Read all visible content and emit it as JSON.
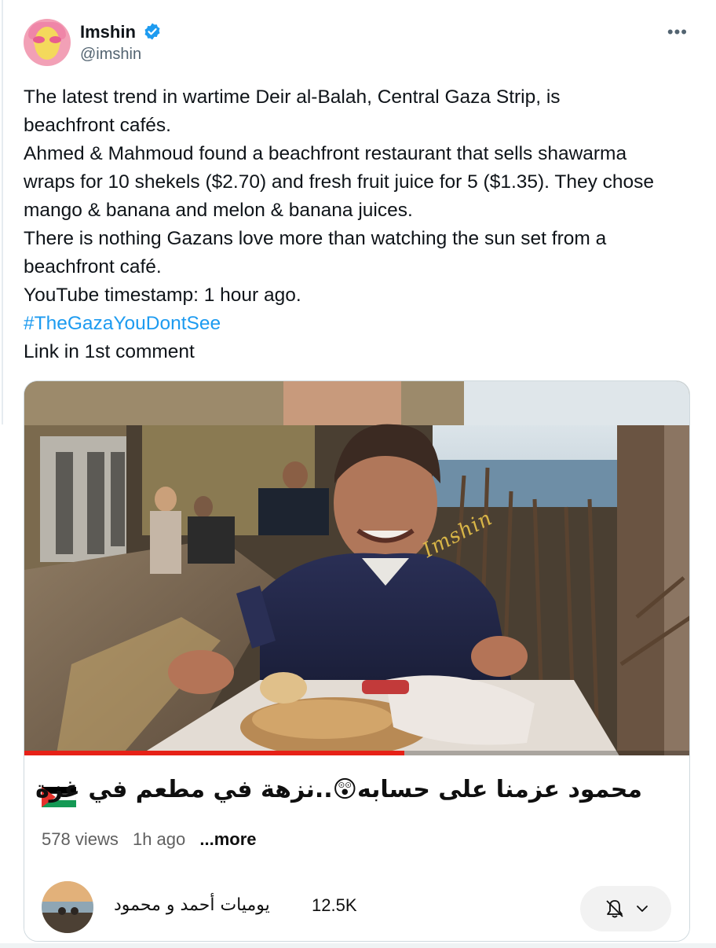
{
  "author": {
    "display_name": "Imshin",
    "handle": "@imshin",
    "verified": true,
    "verified_color": "#1d9bf0",
    "avatar_icon": "avatar-illustration"
  },
  "menu_icon": "more-horizontal-icon",
  "tweet": {
    "lines": [
      "The latest trend in wartime Deir al-Balah, Central Gaza Strip, is",
      "beachfront cafés.",
      "Ahmed & Mahmoud found a beachfront restaurant that sells shawarma",
      "wraps for 10 shekels ($2.70) and fresh fruit juice for 5 ($1.35). They chose",
      "mango & banana and melon & banana juices.",
      "There is nothing Gazans love more than watching the sun set from a",
      "beachfront café.",
      "YouTube timestamp: 1 hour ago."
    ],
    "hashtag": "#TheGazaYouDontSee",
    "hashtag_color": "#1d9bf0",
    "footer_line": "Link in 1st comment"
  },
  "video": {
    "watermark": "Imshin",
    "progress_fraction": 0.57,
    "progress_color": "#e62117",
    "title": "محمود عزمنا على حسابه😲..نزهة في مطعم في غزة",
    "title_flag_icon": "palestine-flag-icon",
    "views": "578 views",
    "age": "1h ago",
    "more_label": "...more",
    "channel_name": "يوميات أحمد و محمود",
    "subscribers": "12.5K",
    "bell_icon": "bell-off-icon",
    "chevron_icon": "chevron-down-icon"
  }
}
